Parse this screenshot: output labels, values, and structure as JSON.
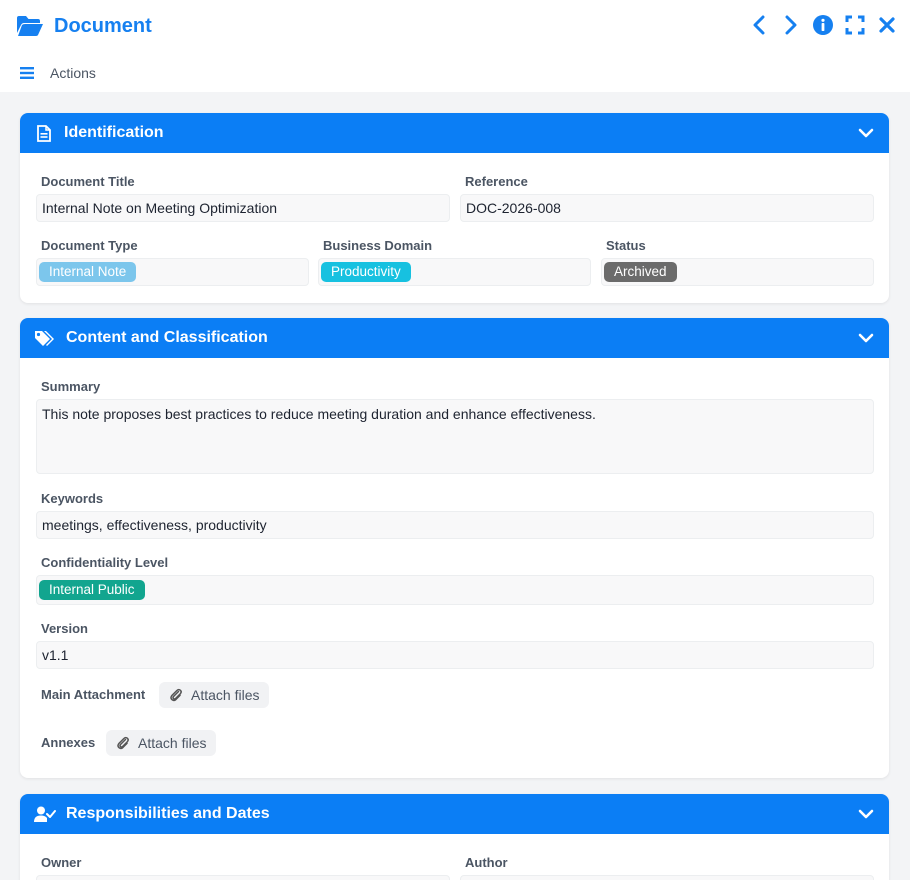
{
  "header": {
    "title": "Document",
    "actions_label": "Actions"
  },
  "colors": {
    "accent": "#0b7ef5",
    "tag_internal_note": "#7cc6ec",
    "tag_productivity": "#17c1e0",
    "tag_archived": "#6b6b6b",
    "tag_internal_public": "#12a58f"
  },
  "sections": {
    "identification": {
      "title": "Identification",
      "icon": "document-icon",
      "document_title_label": "Document Title",
      "document_title_value": "Internal Note on Meeting Optimization",
      "reference_label": "Reference",
      "reference_value": "DOC-2026-008",
      "document_type_label": "Document Type",
      "document_type_value": "Internal Note",
      "business_domain_label": "Business Domain",
      "business_domain_value": "Productivity",
      "status_label": "Status",
      "status_value": "Archived"
    },
    "content": {
      "title": "Content and Classification",
      "icon": "tags-icon",
      "summary_label": "Summary",
      "summary_value": "This note proposes best practices to reduce meeting duration and enhance effectiveness.",
      "keywords_label": "Keywords",
      "keywords_value": "meetings, effectiveness, productivity",
      "confidentiality_label": "Confidentiality Level",
      "confidentiality_value": "Internal Public",
      "version_label": "Version",
      "version_value": "v1.1",
      "main_attachment_label": "Main Attachment",
      "annexes_label": "Annexes",
      "attach_label": "Attach files"
    },
    "responsibilities": {
      "title": "Responsibilities and Dates",
      "icon": "user-check-icon",
      "owner_label": "Owner",
      "author_label": "Author"
    }
  }
}
